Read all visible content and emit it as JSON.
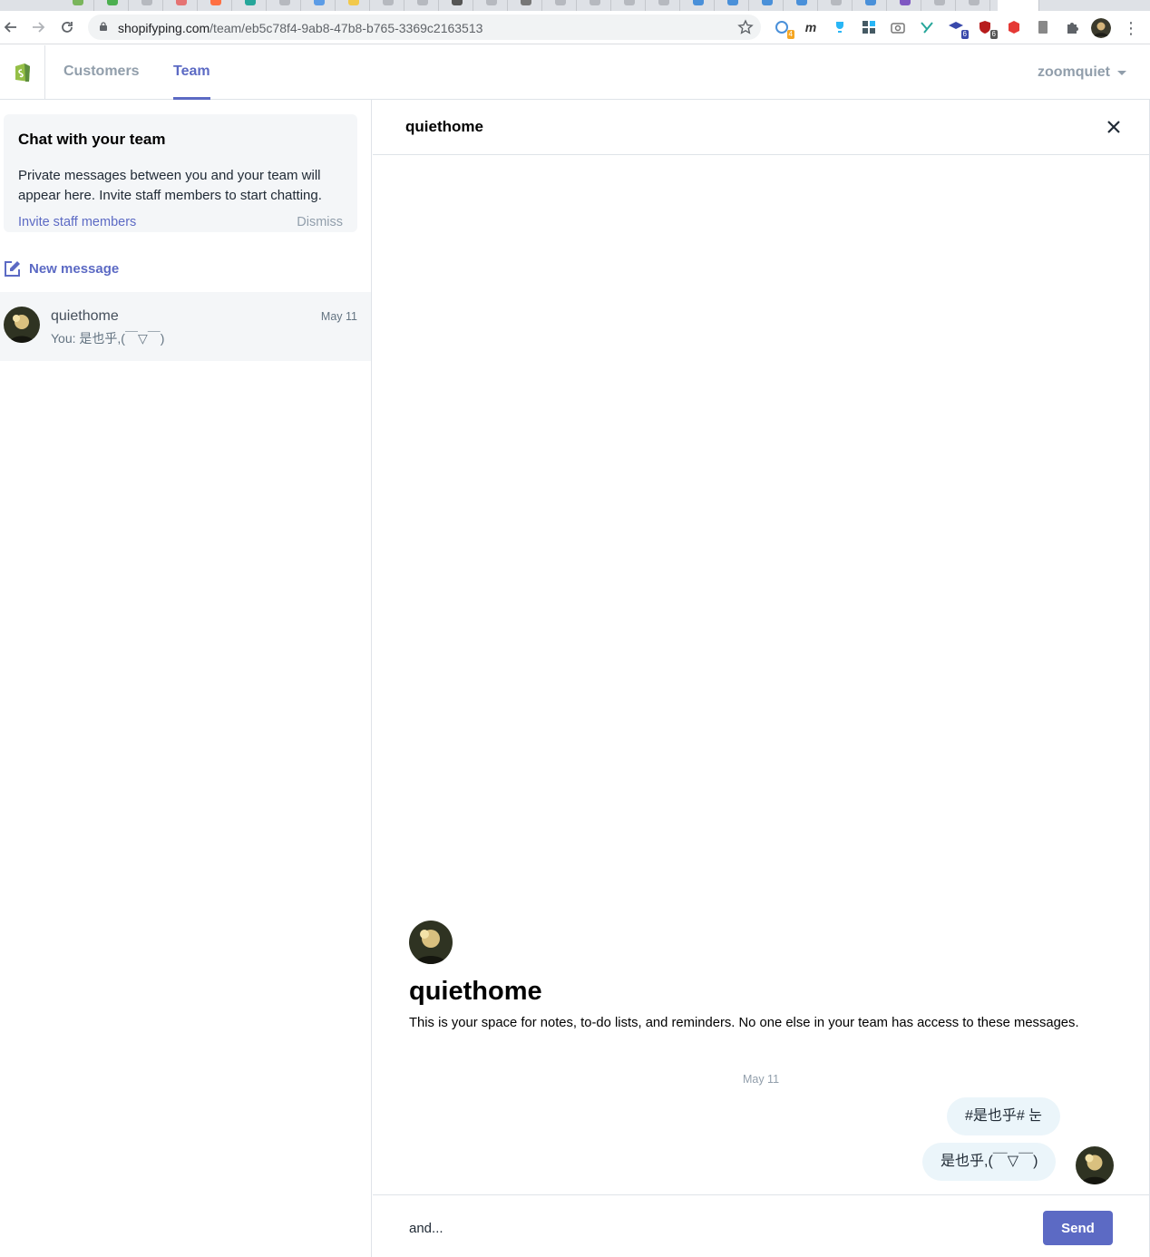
{
  "browser": {
    "url_host": "shopifyping.com",
    "url_path": "/team/eb5c78f4-9ab8-47b8-b765-3369c2163513",
    "ext_badges": [
      "4",
      "6",
      "6"
    ]
  },
  "header": {
    "tabs": [
      {
        "label": "Customers"
      },
      {
        "label": "Team"
      }
    ],
    "active_tab": "Team",
    "user": "zoomquiet"
  },
  "sidebar": {
    "banner": {
      "title": "Chat with your team",
      "body": "Private messages between you and your team will appear here. Invite staff members to start chatting.",
      "invite_label": "Invite staff members",
      "dismiss_label": "Dismiss"
    },
    "new_message_label": "New message",
    "conversations": [
      {
        "name": "quiethome",
        "preview": "You: 是也乎,(￣▽￣)",
        "date": "May 11"
      }
    ]
  },
  "chat": {
    "title": "quiethome",
    "intro_name": "quiethome",
    "intro_desc": "This is your space for notes, to-do lists, and reminders. No one else in your team has access to these messages.",
    "date_separator": "May 11",
    "messages": [
      {
        "text": "#是也乎# 눈"
      },
      {
        "text": "是也乎,(￣▽￣)"
      }
    ],
    "composer_value": "and...",
    "send_label": "Send"
  },
  "colors": {
    "accent": "#5c6ac4",
    "bubble": "#ebf5fa",
    "muted": "#919eab",
    "shopify_green": "#95bf47"
  }
}
